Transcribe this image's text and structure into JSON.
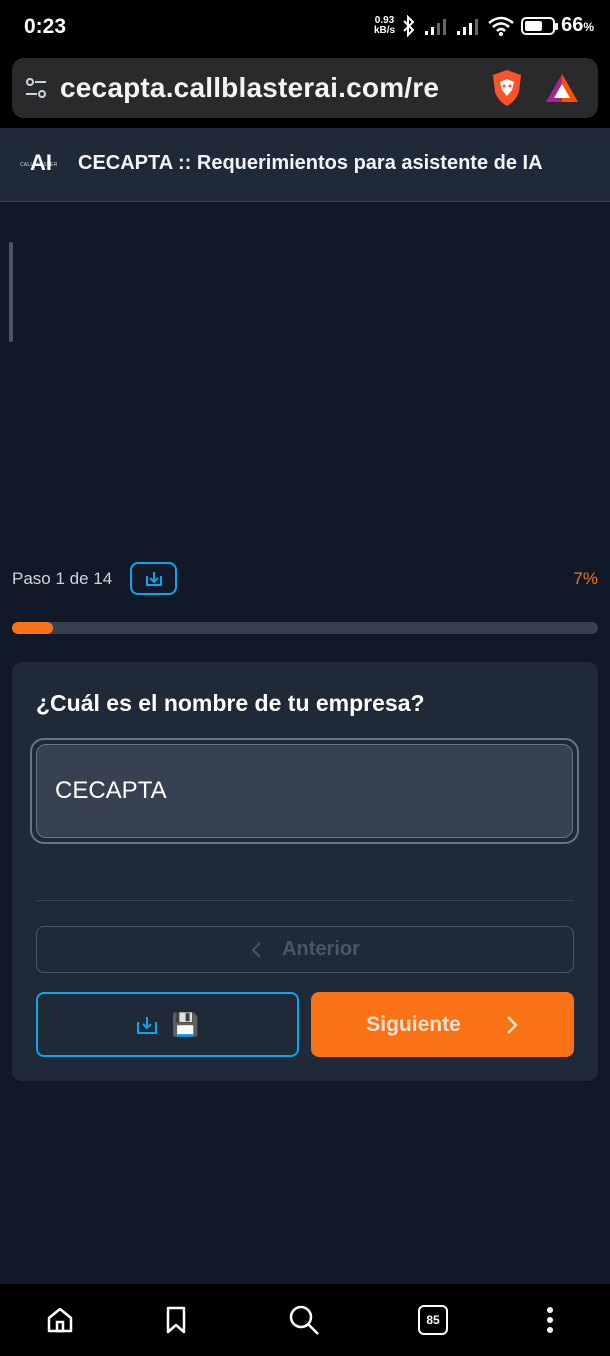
{
  "status_bar": {
    "time": "0:23",
    "net_speed_value": "0.93",
    "net_speed_unit": "kB/s",
    "battery_percent": "66",
    "battery_percent_sign": "%",
    "battery_level": 0.66
  },
  "browser": {
    "url": "cecapta.callblasterai.com/re",
    "tab_count": "85"
  },
  "app": {
    "logo_text": "AI",
    "logo_small_text": "CALLBLASTER",
    "title": "CECAPTA :: Requerimientos para asistente de IA"
  },
  "step": {
    "label": "Paso 1 de 14",
    "percent_label": "7%",
    "progress": 0.07
  },
  "form": {
    "question": "¿Cuál es el nombre de tu empresa?",
    "answer_value": "CECAPTA",
    "prev_label": "Anterior",
    "next_label": "Siguiente",
    "save_emoji": "💾"
  },
  "colors": {
    "accent": "#f97316",
    "save_border": "#0ea5e9",
    "background": "#111827",
    "card": "#1f2937"
  }
}
